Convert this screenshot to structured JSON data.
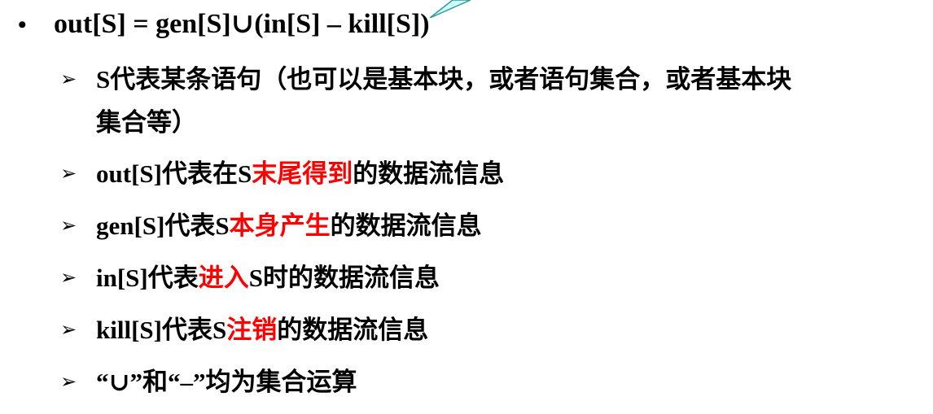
{
  "main": {
    "bullet": "•",
    "formula": "out[S] = gen[S]∪(in[S] – kill[S])"
  },
  "items": [
    {
      "arrow": "➢",
      "line1": "S代表某条语句（也可以是基本块，或者语句集合，或者基本块",
      "line2": "集合等）"
    },
    {
      "arrow": "➢",
      "pre": "out[S]代表在S",
      "highlight": "末尾得到",
      "post": "的数据流信息"
    },
    {
      "arrow": "➢",
      "pre": "gen[S]代表S",
      "highlight": "本身产生",
      "post": "的数据流信息"
    },
    {
      "arrow": "➢",
      "pre": "in[S]代表",
      "highlight": "进入",
      "post": "S时的数据流信息"
    },
    {
      "arrow": "➢",
      "pre": "kill[S]代表S",
      "highlight": "注销",
      "post": "的数据流信息"
    },
    {
      "arrow": "➢",
      "text": "“∪”和“–”均为集合运算"
    }
  ],
  "colors": {
    "text": "#000000",
    "highlight": "#ff0000",
    "callout_fill": "#ccffff",
    "callout_stroke": "#339999"
  }
}
